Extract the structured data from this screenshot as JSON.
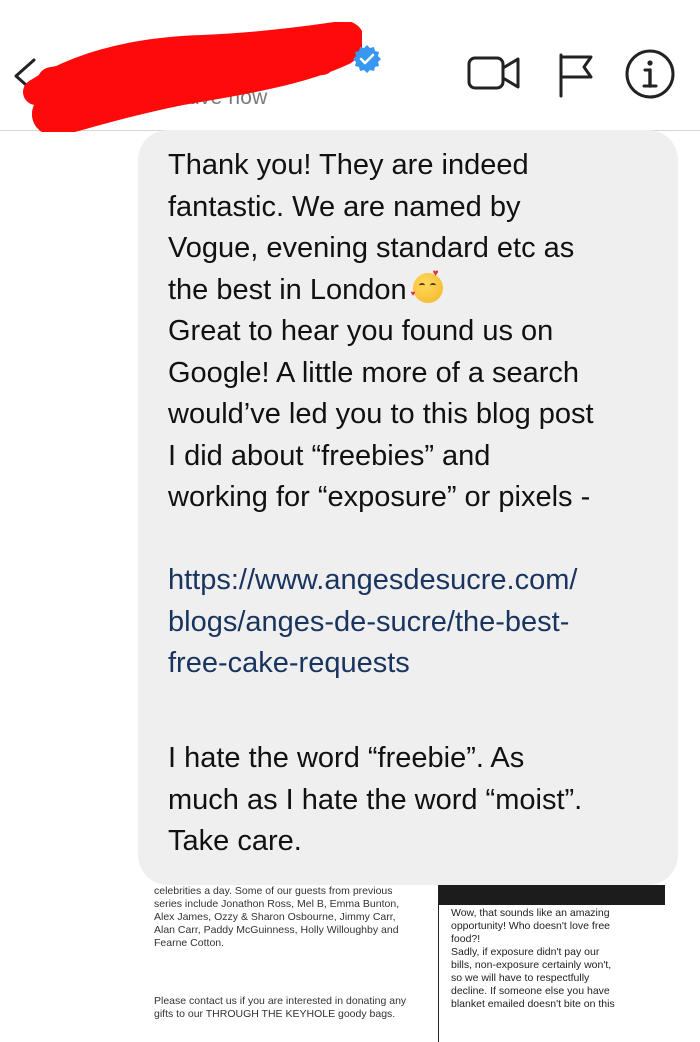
{
  "header": {
    "active_status": "Active now",
    "icons": [
      "back-chevron-icon",
      "verified-badge-icon",
      "video-call-icon",
      "flag-icon",
      "info-icon"
    ]
  },
  "colors": {
    "verified_badge": "#3897f0",
    "redaction_scribble": "#ff0000",
    "bubble_background": "#efefef",
    "link_text": "#19345f"
  },
  "message": {
    "p1": "Thank you! They are indeed\nfantastic. We are named by\nVogue, evening standard etc as\nthe best in London",
    "p1_emoji": "smiling-face-with-hearts-emoji",
    "p2": "Great to hear you found us on\nGoogle! A little more of a search\nwould’ve led you to this blog post\nI did about “freebies” and\nworking for “exposure” or pixels -",
    "link": "https://www.angesdesucre.com/\nblogs/anges-de-sucre/the-best-\nfree-cake-requests",
    "p3": "I hate the word “freebie”. As\nmuch as I hate the word “moist”.\nTake care."
  },
  "attached_screenshot": {
    "left_paragraph_1": "celebrities a day. Some of our guests from previous\nseries include Jonathon Ross, Mel B, Emma Bunton,\nAlex James, Ozzy & Sharon Osbourne, Jimmy Carr,\nAlan Carr, Paddy McGuinness, Holly Willoughby and\nFearne Cotton.",
    "left_paragraph_2": "Please contact us if you are interested in donating any\ngifts to our THROUGH THE KEYHOLE goody bags.",
    "right_text": "Wow, that sounds like an amazing\nopportunity! Who doesn't love free\nfood?!\nSadly, if exposure didn't pay our\nbills, non-exposure certainly won't,\nso we will have to respectfully\ndecline. If someone else you have\nblanket emailed doesn't bite on this"
  }
}
